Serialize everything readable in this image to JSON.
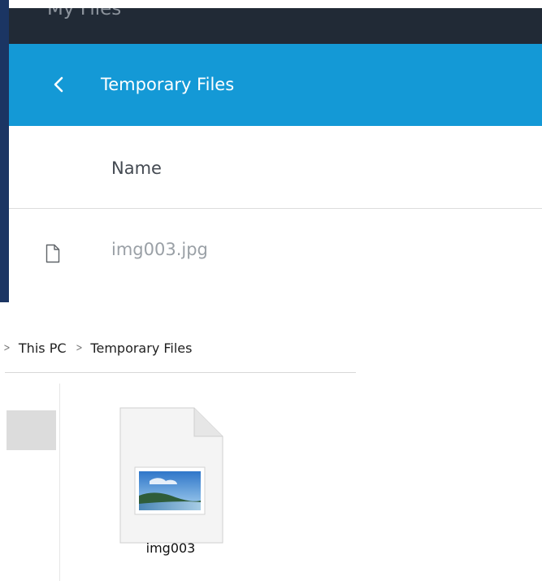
{
  "app": {
    "title": "My Files",
    "folder_title": "Temporary Files",
    "column_name": "Name",
    "files": [
      {
        "name": "img003.jpg",
        "icon": "document-icon"
      }
    ],
    "colors": {
      "accent_bar": "#1b3563",
      "header": "#212a36",
      "folder_bar": "#1499d6"
    }
  },
  "explorer": {
    "breadcrumb": [
      "This PC",
      "Temporary Files"
    ],
    "files": [
      {
        "name": "img003",
        "icon": "image-file-icon"
      }
    ]
  }
}
